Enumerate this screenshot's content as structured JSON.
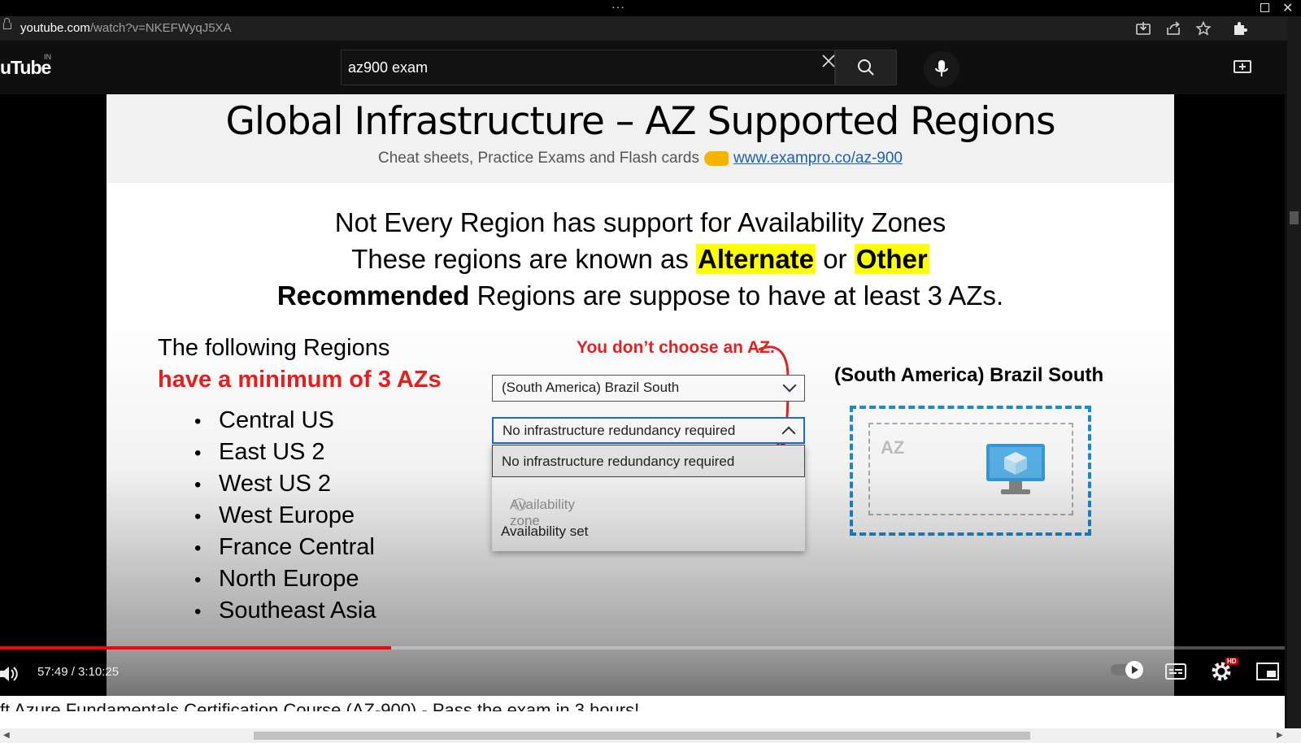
{
  "browser": {
    "url_host": "youtube.com",
    "url_path": "/watch?v=NKEFWyqJ5XA",
    "menu_dots": "···",
    "close_glyph": "✕"
  },
  "youtube": {
    "logo": "uTube",
    "country": "IN",
    "search_value": "az900 exam"
  },
  "slide": {
    "title": "Global Infrastructure – AZ Supported Regions",
    "subtitle_prefix": "Cheat sheets, Practice Exams and Flash cards",
    "subtitle_link": "www.exampro.co/az-900",
    "line1": "Not Every Region has support for Availability Zones",
    "line2_pre": "These regions are known as ",
    "line2_alt": "Alternate",
    "line2_mid": " or ",
    "line2_other": "Other",
    "line3_bold": "Recommended",
    "line3_rest": " Regions are suppose to have at least 3 AZs.",
    "regions_heading": "The following Regions",
    "regions_heading_red": "have a minimum of 3 AZs",
    "regions": [
      "Central US",
      "East US 2",
      "West US 2",
      "West Europe",
      "France Central",
      "North Europe",
      "Southeast Asia"
    ],
    "callout": "You don’t choose an AZ.",
    "region_select": "(South America) Brazil South",
    "redundancy_select": "No infrastructure redundancy required",
    "options": [
      "No infrastructure redundancy required",
      "Availability zone",
      "Availability set"
    ],
    "brazil_title": "(South America) Brazil South",
    "az_label": "AZ"
  },
  "player": {
    "time": "57:49 / 3:10:25",
    "progress_fraction": 0.3044,
    "hd": "HD"
  },
  "below": {
    "title_partial": "ft Azure Fundamentals Certification Course (AZ-900) - Pass the exam in 3 hours!"
  },
  "colors": {
    "progress": "#ff0000",
    "highlight": "#ffff00",
    "callout_red": "#e82020",
    "az_blue": "#1a8fd6"
  }
}
